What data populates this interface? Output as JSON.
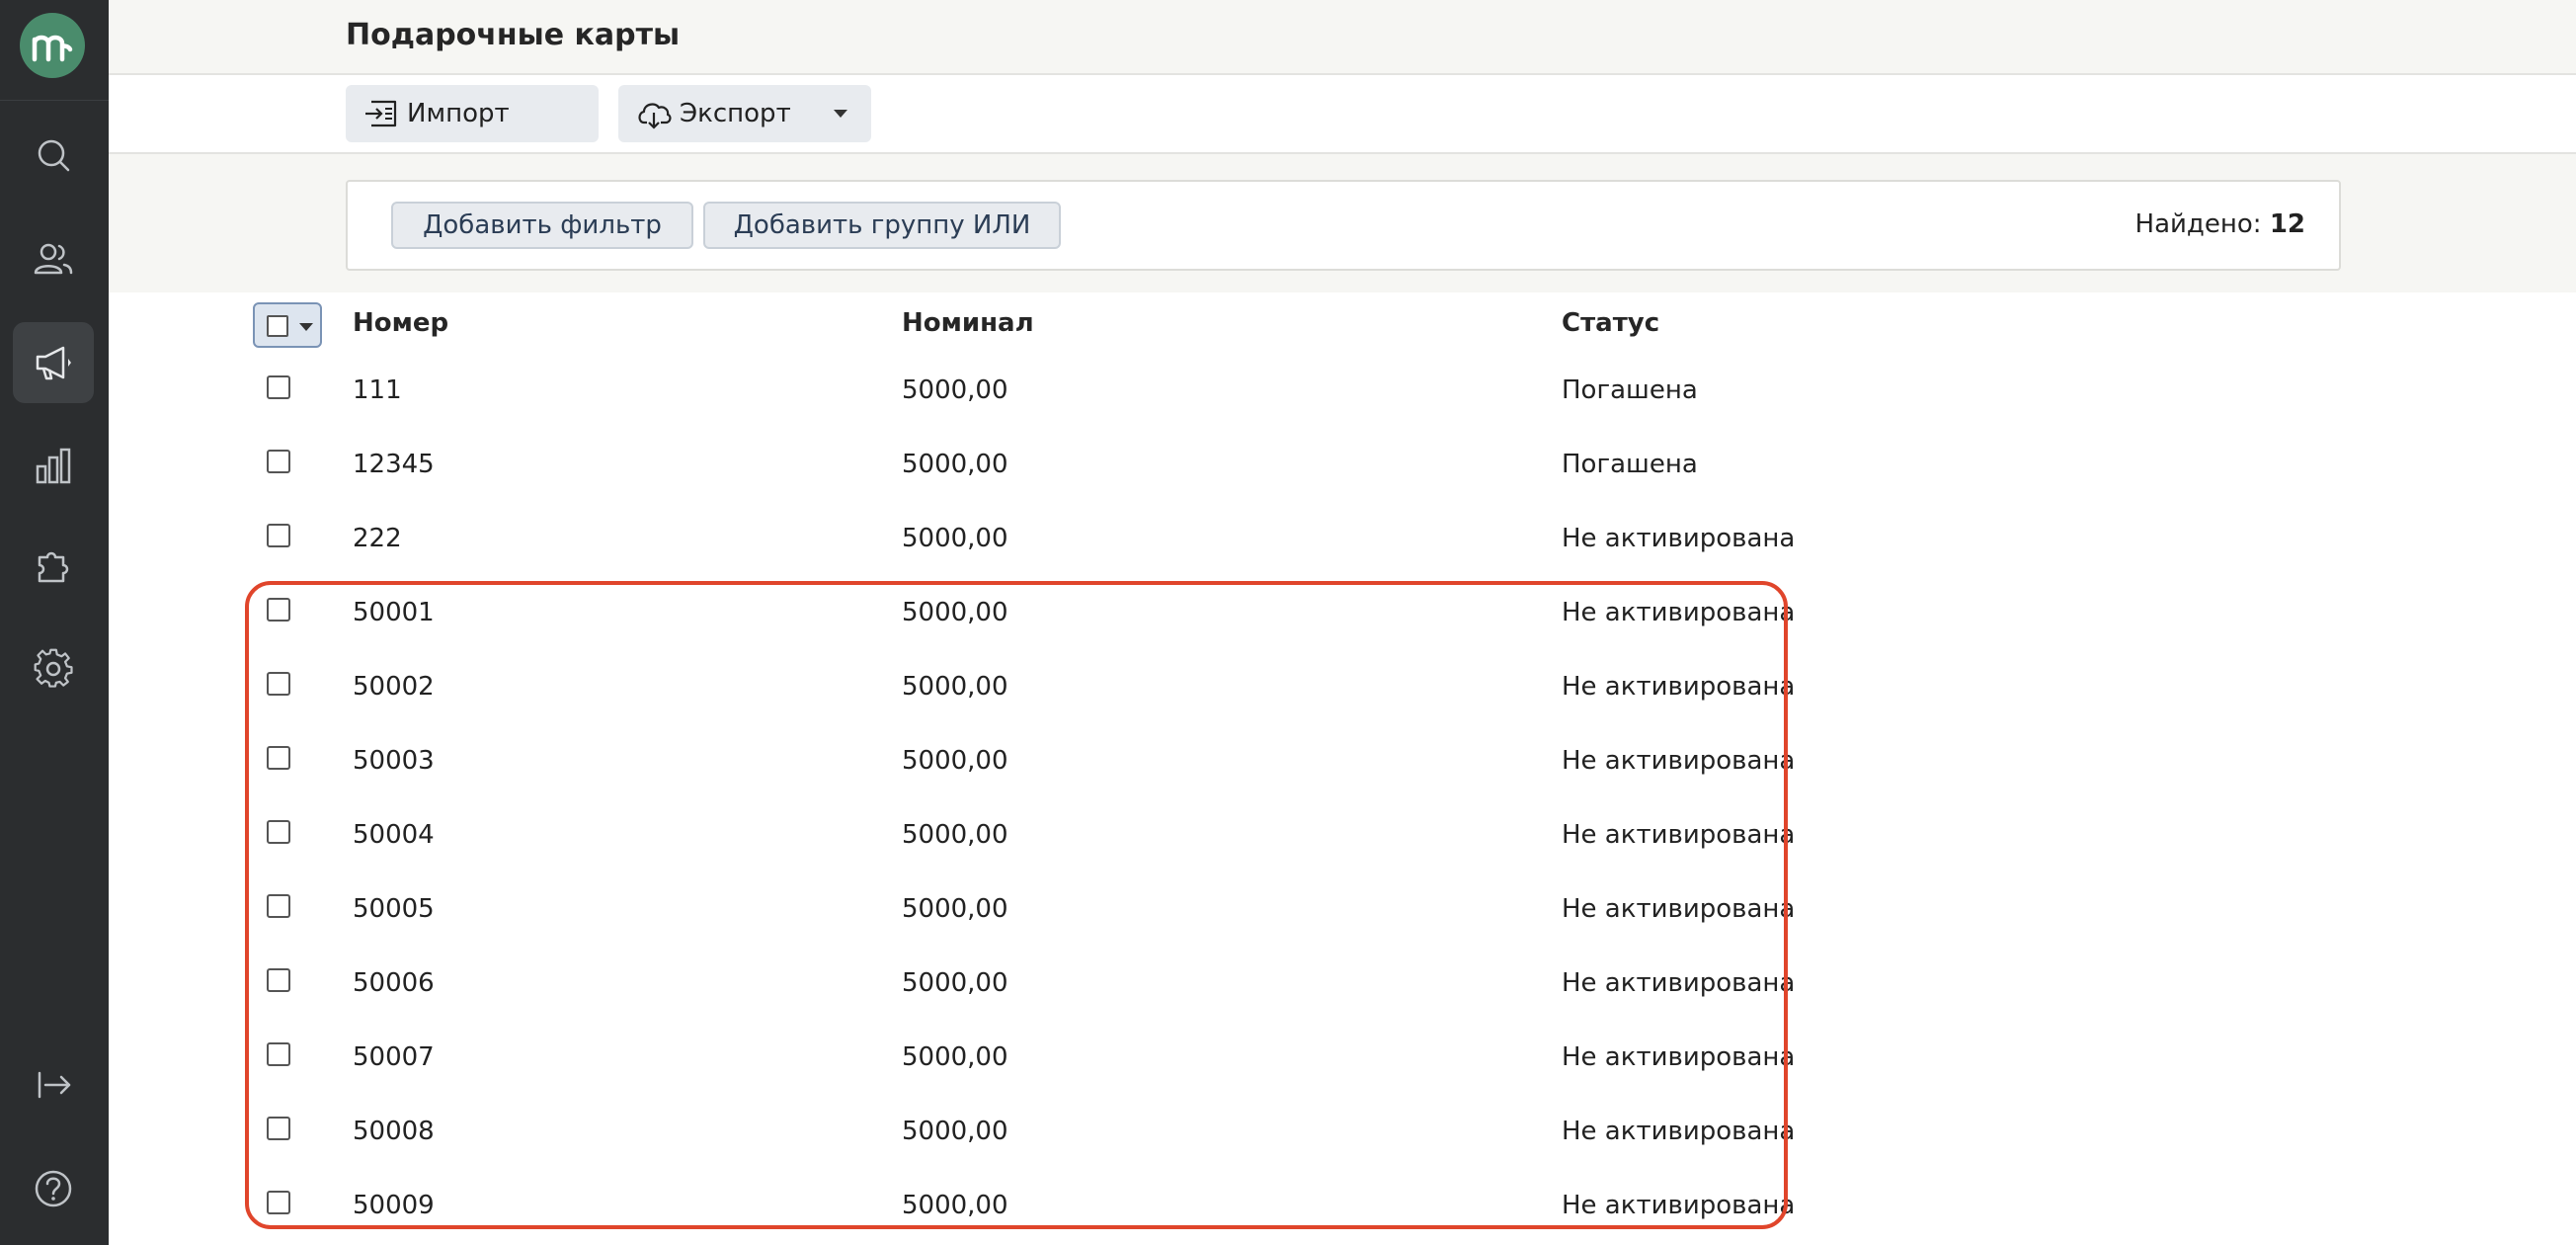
{
  "app": {
    "logo_letter": "m",
    "accent_color": "#4a8c6c",
    "highlight_color": "#e0452b"
  },
  "sidebar": {
    "items": [
      {
        "icon": "search-icon"
      },
      {
        "icon": "users-icon"
      },
      {
        "icon": "megaphone-icon",
        "active": true
      },
      {
        "icon": "bar-chart-icon"
      },
      {
        "icon": "puzzle-icon"
      },
      {
        "icon": "gear-icon"
      }
    ],
    "bottom_items": [
      {
        "icon": "logout-icon"
      },
      {
        "icon": "help-icon"
      }
    ]
  },
  "header": {
    "title": "Подарочные карты"
  },
  "toolbar": {
    "import_label": "Импорт",
    "export_label": "Экспорт"
  },
  "filters": {
    "add_filter_label": "Добавить фильтр",
    "add_or_group_label": "Добавить группу ИЛИ",
    "found_label": "Найдено:",
    "found_count": "12"
  },
  "table": {
    "columns": [
      "Номер",
      "Номинал",
      "Статус"
    ],
    "rows": [
      {
        "number": "111",
        "nominal": "5000,00",
        "status": "Погашена"
      },
      {
        "number": "12345",
        "nominal": "5000,00",
        "status": "Погашена"
      },
      {
        "number": "222",
        "nominal": "5000,00",
        "status": "Не активирована"
      },
      {
        "number": "50001",
        "nominal": "5000,00",
        "status": "Не активирована"
      },
      {
        "number": "50002",
        "nominal": "5000,00",
        "status": "Не активирована"
      },
      {
        "number": "50003",
        "nominal": "5000,00",
        "status": "Не активирована"
      },
      {
        "number": "50004",
        "nominal": "5000,00",
        "status": "Не активирована"
      },
      {
        "number": "50005",
        "nominal": "5000,00",
        "status": "Не активирована"
      },
      {
        "number": "50006",
        "nominal": "5000,00",
        "status": "Не активирована"
      },
      {
        "number": "50007",
        "nominal": "5000,00",
        "status": "Не активирована"
      },
      {
        "number": "50008",
        "nominal": "5000,00",
        "status": "Не активирована"
      },
      {
        "number": "50009",
        "nominal": "5000,00",
        "status": "Не активирована"
      }
    ]
  }
}
